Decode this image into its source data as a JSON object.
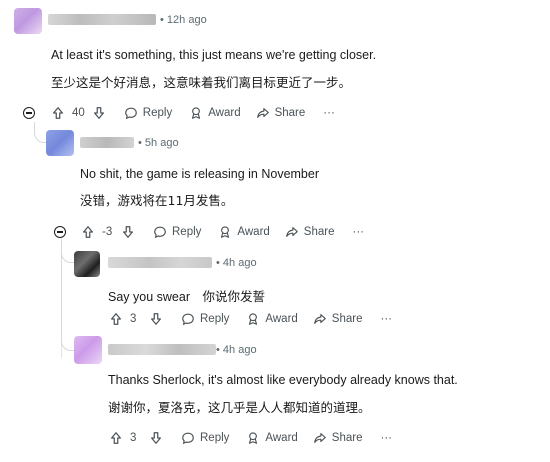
{
  "colors": {
    "text": "#1a1a1b",
    "meta": "#5c6b73",
    "action": "#4a5257",
    "thread": "#e0e3e5"
  },
  "comments": [
    {
      "time": "12h ago",
      "text_en": "At least it's something, this just means we're getting closer.",
      "text_cn": "至少这是个好消息，这意味着我们离目标更近了一步。",
      "votes": "40",
      "reply_label": "Reply",
      "award_label": "Award",
      "share_label": "Share",
      "more_label": "···"
    },
    {
      "time": "5h ago",
      "text_en": "No shit, the game is releasing in November",
      "text_cn": "没错，游戏将在11月发售。",
      "votes": "-3",
      "reply_label": "Reply",
      "award_label": "Award",
      "share_label": "Share",
      "more_label": "···"
    },
    {
      "time": "4h ago",
      "text_en": "Say you swear",
      "text_cn": "你说你发誓",
      "votes": "3",
      "reply_label": "Reply",
      "award_label": "Award",
      "share_label": "Share",
      "more_label": "···"
    },
    {
      "time": "4h ago",
      "text_en": "Thanks Sherlock, it's almost like everybody already knows that.",
      "text_cn": "谢谢你，夏洛克，这几乎是人人都知道的道理。",
      "votes": "3",
      "reply_label": "Reply",
      "award_label": "Award",
      "share_label": "Share",
      "more_label": "···"
    }
  ],
  "time_prefix": "•"
}
